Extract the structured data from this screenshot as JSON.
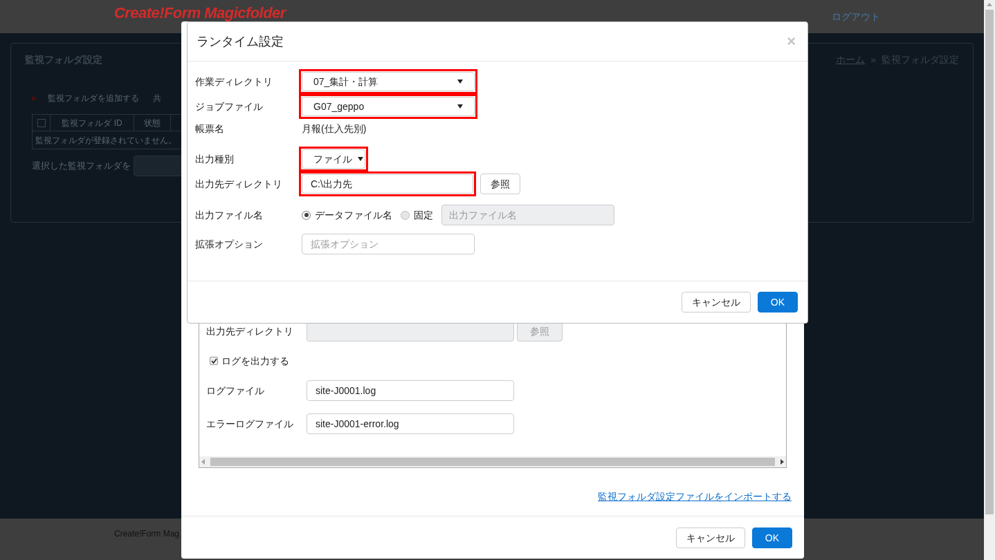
{
  "page": {
    "brand": "Create!Form Magicfolder",
    "logout": "ログアウト",
    "panel_title": "監視フォルダ設定",
    "breadcrumb": [
      {
        "label": "ホーム",
        "link": true
      },
      {
        "label": "監視フォルダ設定",
        "link": false
      }
    ],
    "breadcrumb_separator": "»",
    "actions": [
      {
        "label": "監視フォルダを追加する"
      },
      {
        "label": "共"
      }
    ],
    "table": {
      "select_all_checked": false,
      "columns": [
        "監視フォルダ ID",
        "状態"
      ],
      "empty_message": "監視フォルダが登録されていません。"
    },
    "bulk_label": "選択した監視フォルダを",
    "footer": "Create!Form Mag"
  },
  "settings_dialog": {
    "output_dir": {
      "label": "出力先ディレクトリ",
      "browse": "参照",
      "disabled": true
    },
    "log": {
      "label": "ログを出力する",
      "checked": true
    },
    "fields": [
      {
        "label": "ログファイル",
        "value": "site-J0001.log"
      },
      {
        "label": "エラーログファイル",
        "value": "site-J0001-error.log"
      }
    ],
    "import_link": "監視フォルダ設定ファイルをインポートする",
    "buttons": [
      {
        "label": "キャンセル",
        "primary": false
      },
      {
        "label": "OK",
        "primary": true
      }
    ]
  },
  "runtime_dialog": {
    "title": "ランタイム設定",
    "close": "×",
    "rows": [
      {
        "kind": "select",
        "label": "作業ディレクトリ",
        "value": "07_集計・計算",
        "highlighted": true
      },
      {
        "kind": "select",
        "label": "ジョブファイル",
        "value": "G07_geppo",
        "highlighted": true
      },
      {
        "kind": "text",
        "label": "帳票名",
        "value": "月報(仕入先別)"
      },
      {
        "kind": "choice",
        "label": "出力種別",
        "value": "ファイル",
        "highlighted": true
      },
      {
        "kind": "path",
        "label": "出力先ディレクトリ",
        "value": "C:\\出力先",
        "browse": "参照",
        "highlighted": true
      },
      {
        "kind": "radio",
        "label": "出力ファイル名",
        "options": [
          {
            "label": "データファイル名",
            "selected": true
          },
          {
            "label": "固定",
            "selected": false
          }
        ],
        "placeholder": "出力ファイル名"
      },
      {
        "kind": "input",
        "label": "拡張オプション",
        "placeholder": "拡張オプション"
      }
    ],
    "buttons": [
      {
        "label": "キャンセル",
        "primary": false
      },
      {
        "label": "OK",
        "primary": true
      }
    ]
  }
}
